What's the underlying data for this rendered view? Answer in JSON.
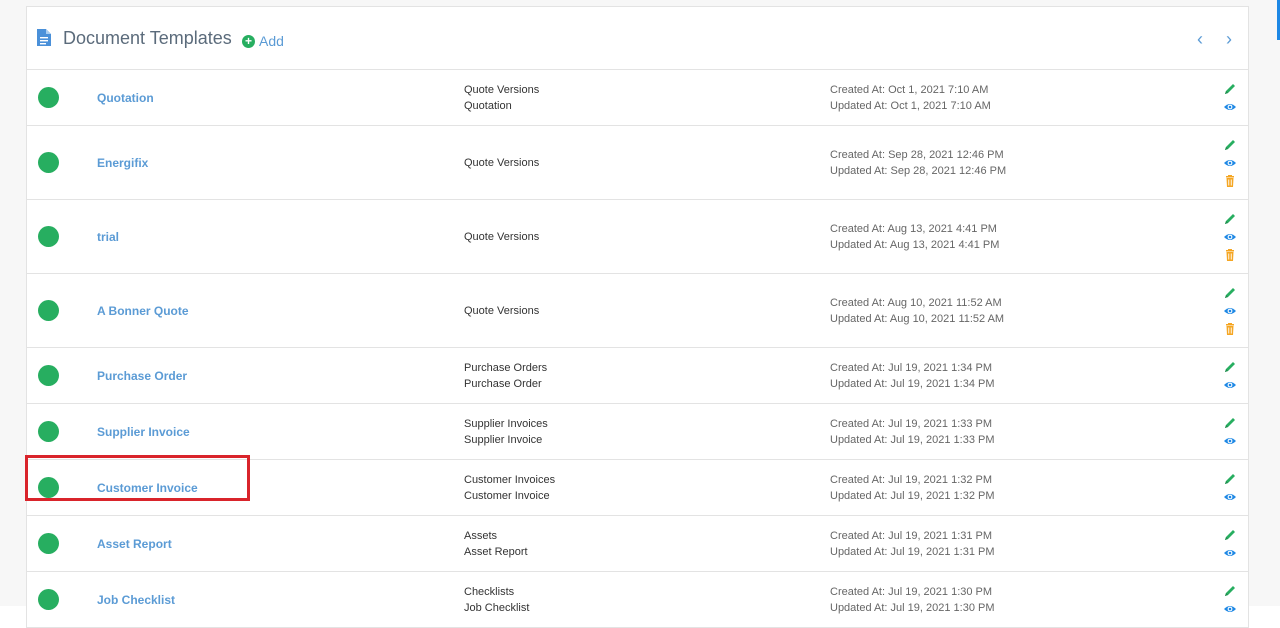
{
  "header": {
    "title": "Document Templates",
    "add_label": "Add"
  },
  "rows": [
    {
      "name": "Quotation",
      "modules": [
        "Quote Versions",
        "Quotation"
      ],
      "created": "Created At: Oct 1, 2021 7:10 AM",
      "updated": "Updated At: Oct 1, 2021 7:10 AM",
      "deletable": false
    },
    {
      "name": "Energifix",
      "modules": [
        "Quote Versions"
      ],
      "created": "Created At: Sep 28, 2021 12:46 PM",
      "updated": "Updated At: Sep 28, 2021 12:46 PM",
      "deletable": true
    },
    {
      "name": "trial",
      "modules": [
        "Quote Versions"
      ],
      "created": "Created At: Aug 13, 2021 4:41 PM",
      "updated": "Updated At: Aug 13, 2021 4:41 PM",
      "deletable": true
    },
    {
      "name": "A Bonner Quote",
      "modules": [
        "Quote Versions"
      ],
      "created": "Created At: Aug 10, 2021 11:52 AM",
      "updated": "Updated At: Aug 10, 2021 11:52 AM",
      "deletable": true
    },
    {
      "name": "Purchase Order",
      "modules": [
        "Purchase Orders",
        "Purchase Order"
      ],
      "created": "Created At: Jul 19, 2021 1:34 PM",
      "updated": "Updated At: Jul 19, 2021 1:34 PM",
      "deletable": false
    },
    {
      "name": "Supplier Invoice",
      "modules": [
        "Supplier Invoices",
        "Supplier Invoice"
      ],
      "created": "Created At: Jul 19, 2021 1:33 PM",
      "updated": "Updated At: Jul 19, 2021 1:33 PM",
      "deletable": false
    },
    {
      "name": "Customer Invoice",
      "modules": [
        "Customer Invoices",
        "Customer Invoice"
      ],
      "created": "Created At: Jul 19, 2021 1:32 PM",
      "updated": "Updated At: Jul 19, 2021 1:32 PM",
      "deletable": false
    },
    {
      "name": "Asset Report",
      "modules": [
        "Assets",
        "Asset Report"
      ],
      "created": "Created At: Jul 19, 2021 1:31 PM",
      "updated": "Updated At: Jul 19, 2021 1:31 PM",
      "deletable": false
    },
    {
      "name": "Job Checklist",
      "modules": [
        "Checklists",
        "Job Checklist"
      ],
      "created": "Created At: Jul 19, 2021 1:30 PM",
      "updated": "Updated At: Jul 19, 2021 1:30 PM",
      "deletable": false
    }
  ],
  "colors": {
    "accent_blue": "#5b9bd5",
    "status_green": "#27ae60",
    "delete_orange": "#f5a623",
    "highlight_red": "#d9242b"
  },
  "icons": {
    "edit": "pencil-icon",
    "view": "eye-icon",
    "delete": "trash-icon",
    "prev": "chevron-left-icon",
    "next": "chevron-right-icon"
  }
}
